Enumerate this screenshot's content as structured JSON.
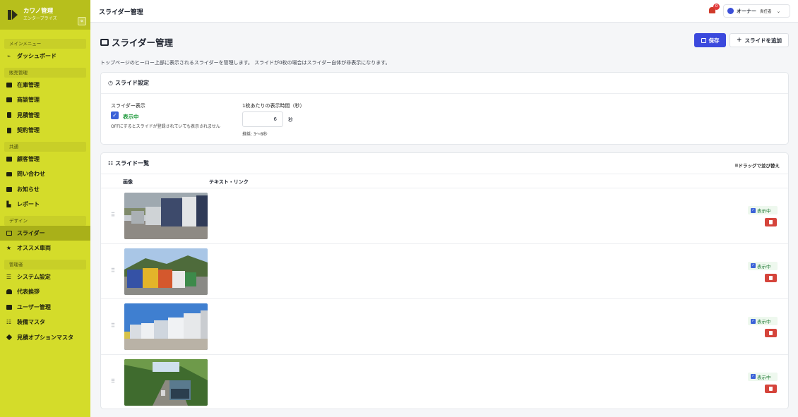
{
  "brand": {
    "name": "カワノ管理",
    "sub": "エンタープライズ"
  },
  "sidebar": {
    "sections": [
      {
        "label": "メインメニュー",
        "items": [
          {
            "label": "ダッシュボード",
            "icon": "chart-line-icon"
          }
        ]
      },
      {
        "label": "販売管理",
        "items": [
          {
            "label": "在庫管理",
            "icon": "truck-icon"
          },
          {
            "label": "商談管理",
            "icon": "handshake-icon"
          },
          {
            "label": "見積管理",
            "icon": "file-icon"
          },
          {
            "label": "契約管理",
            "icon": "file-contract-icon"
          }
        ]
      },
      {
        "label": "共通",
        "items": [
          {
            "label": "顧客管理",
            "icon": "users-icon"
          },
          {
            "label": "問い合わせ",
            "icon": "envelope-icon"
          },
          {
            "label": "お知らせ",
            "icon": "megaphone-icon"
          },
          {
            "label": "レポート",
            "icon": "chart-bar-icon"
          }
        ]
      },
      {
        "label": "デザイン",
        "items": [
          {
            "label": "スライダー",
            "icon": "images-icon",
            "active": true
          },
          {
            "label": "オススメ車両",
            "icon": "star-icon"
          }
        ]
      },
      {
        "label": "管理者",
        "items": [
          {
            "label": "システム設定",
            "icon": "sliders-icon"
          },
          {
            "label": "代表挨拶",
            "icon": "user-icon"
          },
          {
            "label": "ユーザー管理",
            "icon": "users-cog-icon"
          },
          {
            "label": "装備マスタ",
            "icon": "list-icon"
          },
          {
            "label": "見積オプションマスタ",
            "icon": "tag-icon"
          }
        ]
      }
    ]
  },
  "topbar": {
    "title": "スライダー管理",
    "notifications": "0",
    "user_name": "オーナー",
    "user_role": "責任者"
  },
  "page": {
    "title": "スライダー管理",
    "save_label": "保存",
    "add_label": "スライドを追加",
    "description": "トップページのヒーロー上部に表示されるスライダーを管理します。 スライドが0枚の場合はスライダー自体が非表示になります。"
  },
  "settings": {
    "heading": "スライド設定",
    "display_label": "スライダー表示",
    "display_value": "表示中",
    "display_hint": "OFFにするとスライドが登録されていても表示されません",
    "duration_label": "1枚あたりの表示時間（秒）",
    "duration_value": "6",
    "duration_unit": "秒",
    "duration_hint": "推奨: 3〜8秒"
  },
  "slides": {
    "heading": "スライド一覧",
    "drag_hint": "ドラッグで並び替え",
    "col_image": "画像",
    "col_text": "テキスト・リンク",
    "items": [
      {
        "status": "表示中",
        "scene": "truck-depot"
      },
      {
        "status": "表示中",
        "scene": "dump-trucks-hills"
      },
      {
        "status": "表示中",
        "scene": "trucks-blue-sky"
      },
      {
        "status": "表示中",
        "scene": "truck-forest-road"
      }
    ]
  },
  "colors": {
    "sidebar": "#d4dc2a",
    "accent": "#3b49dd",
    "success": "#1f9a3c",
    "danger": "#d5443b"
  }
}
